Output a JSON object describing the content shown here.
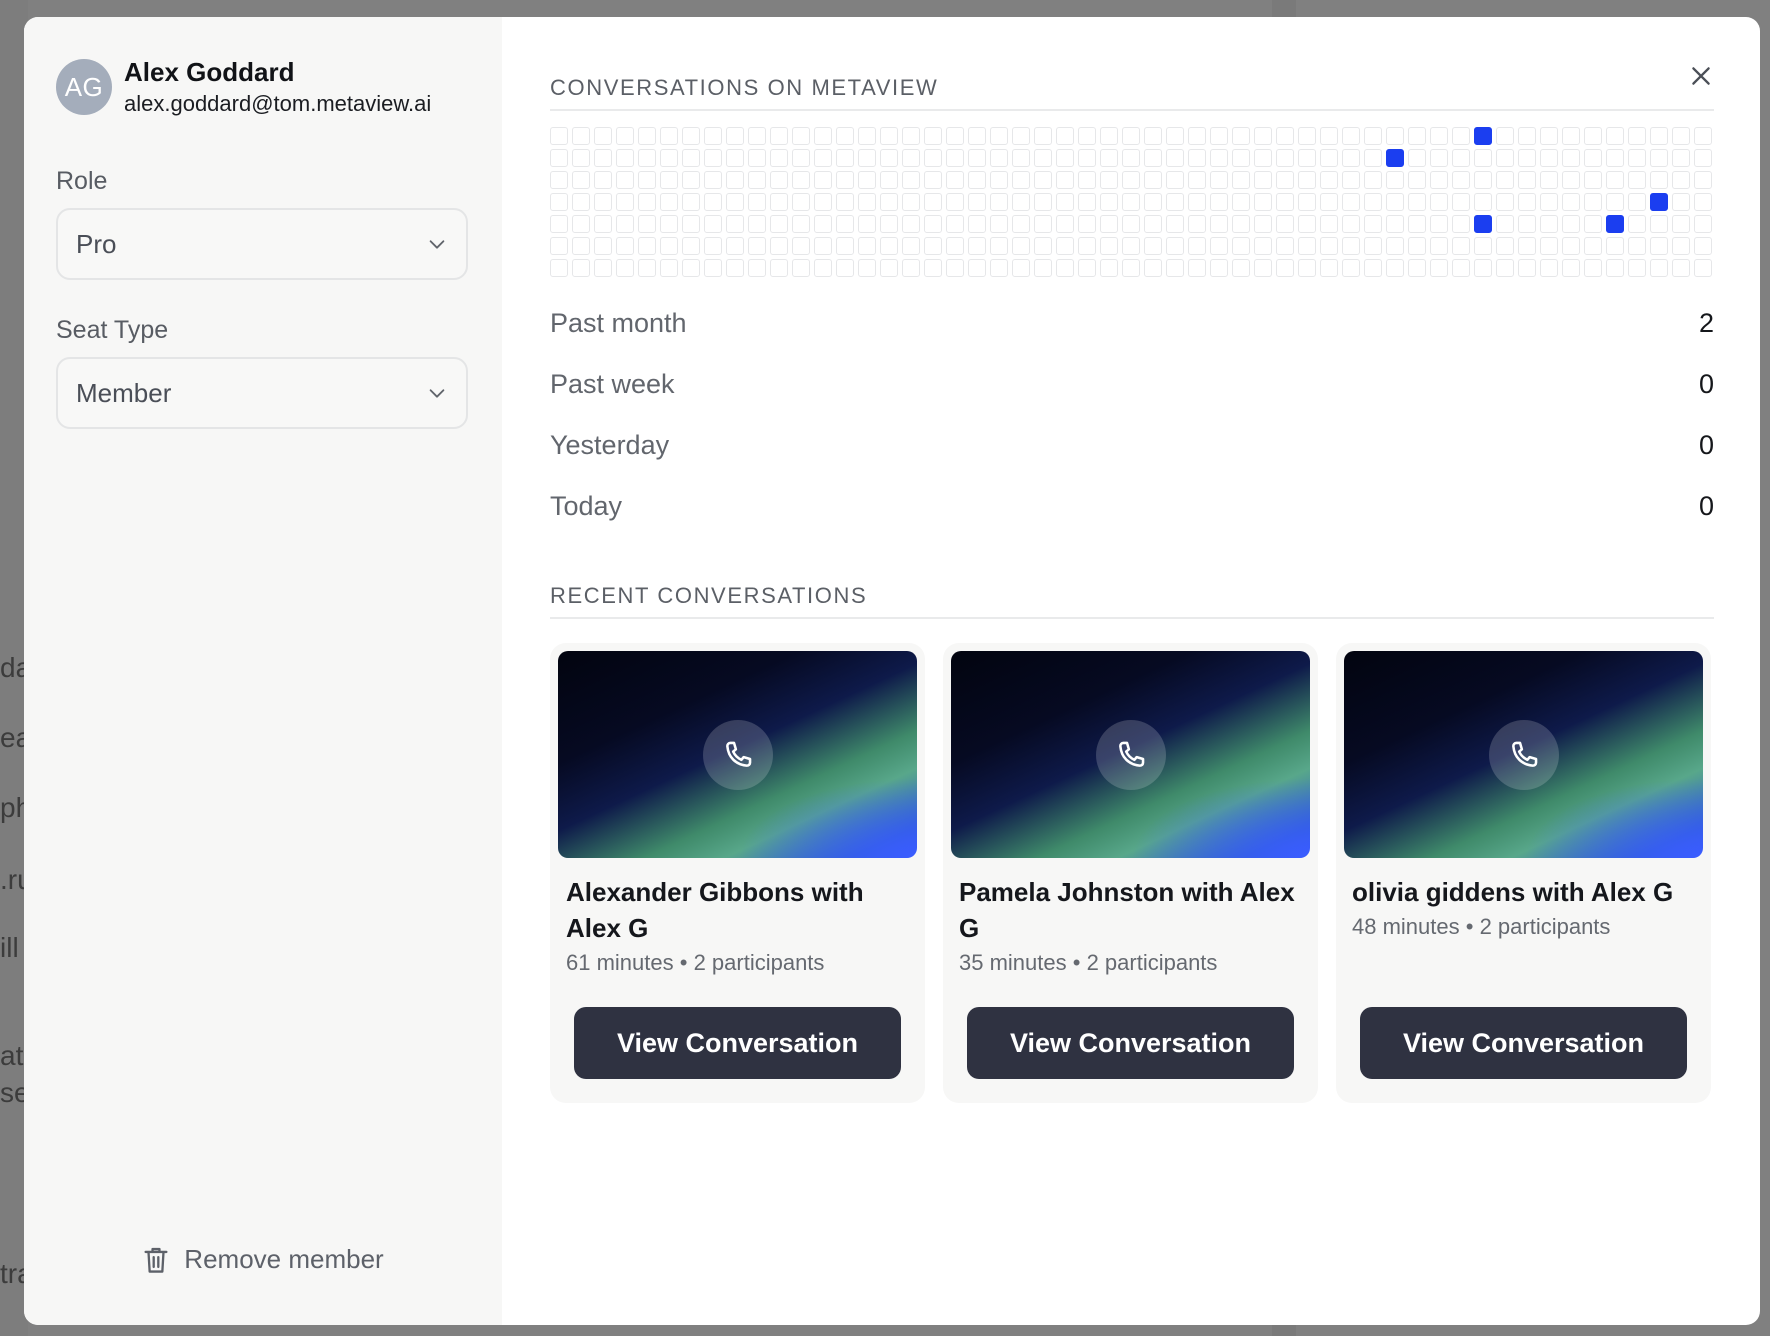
{
  "user": {
    "initials": "AG",
    "name": "Alex Goddard",
    "email": "alex.goddard@tom.metaview.ai"
  },
  "role": {
    "label": "Role",
    "value": "Pro"
  },
  "seat": {
    "label": "Seat Type",
    "value": "Member"
  },
  "remove_label": "Remove member",
  "activity": {
    "title": "CONVERSATIONS ON METAVIEW",
    "columns": 53,
    "rows": 7,
    "active_cells": [
      [
        42,
        0
      ],
      [
        38,
        1
      ],
      [
        50,
        3
      ],
      [
        42,
        4
      ],
      [
        48,
        4
      ]
    ],
    "accent": "#1b3ef0"
  },
  "stats": [
    {
      "label": "Past month",
      "value": "2"
    },
    {
      "label": "Past week",
      "value": "0"
    },
    {
      "label": "Yesterday",
      "value": "0"
    },
    {
      "label": "Today",
      "value": "0"
    }
  ],
  "recent": {
    "title": "RECENT CONVERSATIONS",
    "cards": [
      {
        "title": "Alexander Gibbons with Alex G",
        "duration": "61 minutes",
        "participants": "2 participants",
        "button": "View Conversation"
      },
      {
        "title": "Pamela Johnston with Alex G",
        "duration": "35 minutes",
        "participants": "2 participants",
        "button": "View Conversation"
      },
      {
        "title": "olivia giddens with Alex G",
        "duration": "48 minutes",
        "participants": "2 participants",
        "button": "View Conversation"
      }
    ]
  },
  "background_fragments": [
    "da",
    "ea",
    "ph",
    ".ru",
    "ill",
    "ati",
    "se",
    "tra"
  ],
  "icons": {
    "close": "close-icon",
    "chevron": "chevron-down-icon",
    "trash": "trash-icon",
    "phone": "phone-icon"
  }
}
